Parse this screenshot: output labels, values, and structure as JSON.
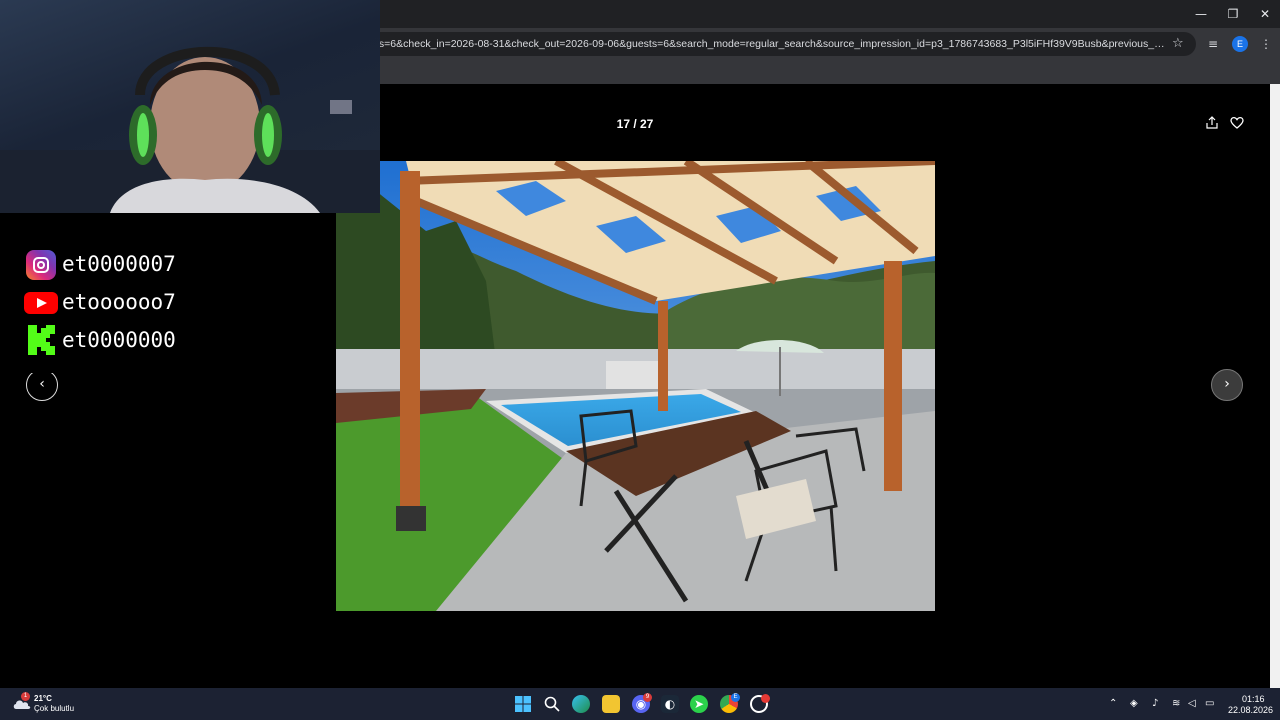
{
  "browser": {
    "url": "ts=6&check_in=2026-08-31&check_out=2026-09-06&guests=6&search_mode=regular_search&source_impression_id=p3_1786743683_P3l5iFHf39V9Busb&previous_page_section_na...",
    "profile_initial": "E",
    "window_controls": {
      "minimize": "—",
      "restore": "❐",
      "close": "✕"
    }
  },
  "gallery": {
    "counter": "17 / 27",
    "prev_label": "‹",
    "next_label": "›",
    "share_icon": "share-icon",
    "save_icon": "heart-icon"
  },
  "socials": [
    {
      "platform": "instagram",
      "handle": "et0000007"
    },
    {
      "platform": "youtube",
      "handle": "etoooooo7"
    },
    {
      "platform": "kick",
      "handle": "et0000000"
    }
  ],
  "taskbar": {
    "weather_temp": "21°C",
    "weather_desc": "Çok bulutlu",
    "weather_badge": "1",
    "discord_badge": "9",
    "chrome_badge": "E",
    "time": "01:16",
    "date": "22.08.2026"
  },
  "colors": {
    "page_bg": "#000000",
    "chrome_dark": "#202124",
    "chrome_toolbar": "#35363a",
    "taskbar": "#1c2233",
    "accent_blue": "#1a73e8"
  }
}
